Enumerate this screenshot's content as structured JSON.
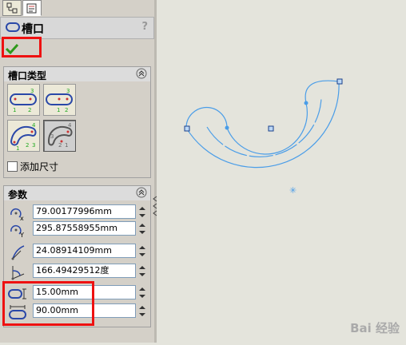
{
  "feature_title": "槽口",
  "help_label": "?",
  "groups": {
    "slot_type": {
      "title": "槽口类型"
    },
    "params": {
      "title": "参数"
    }
  },
  "add_dimensions_label": "添加尺寸",
  "params": [
    {
      "icon": "center-x-icon",
      "value": "79.00177996mm"
    },
    {
      "icon": "center-y-icon",
      "value": "295.87558955mm"
    },
    {
      "icon": "arc-radius-icon",
      "value": "24.08914109mm"
    },
    {
      "icon": "arc-angle-icon",
      "value": "166.49429512度"
    },
    {
      "icon": "slot-width-icon",
      "value": "15.00mm"
    },
    {
      "icon": "slot-length-icon",
      "value": "90.00mm"
    }
  ],
  "slot_type_labels": {
    "straight": [
      "1",
      "2",
      "3"
    ],
    "centerpoint": [
      "1",
      "2",
      "3"
    ],
    "arc3": [
      "1",
      "2",
      "3",
      "4"
    ],
    "centerpoint_arc": [
      "1",
      "2",
      "3",
      "4"
    ]
  },
  "watermark": "Bai 经验",
  "colors": {
    "highlight": "#e11111",
    "sketch": "#4a9de8",
    "accent": "#2a48a8"
  }
}
